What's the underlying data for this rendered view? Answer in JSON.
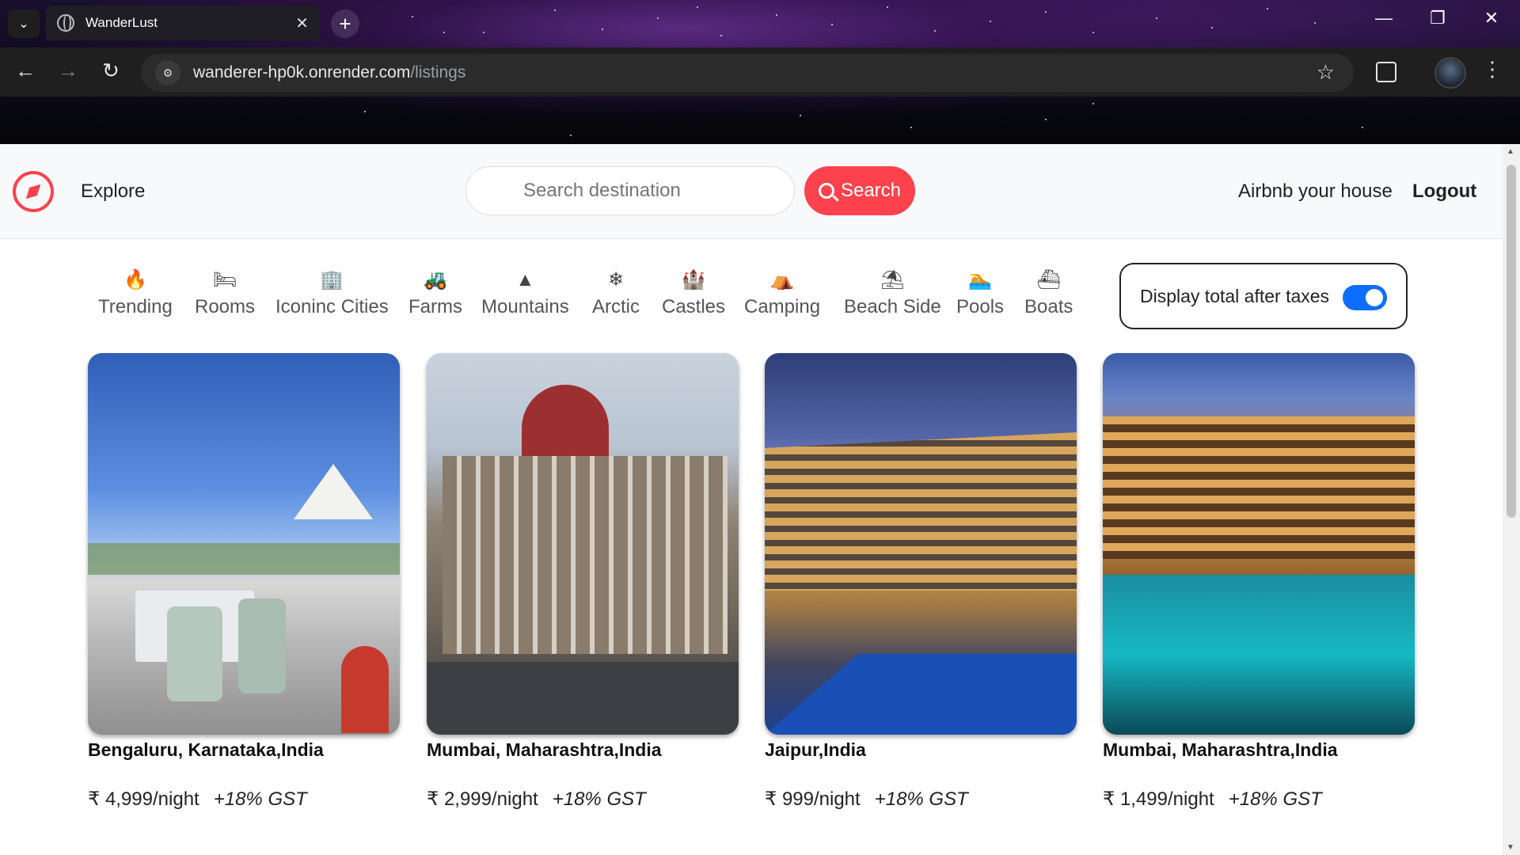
{
  "browser": {
    "tab_title": "WanderLust",
    "tab_close": "✕",
    "new_tab": "+",
    "url_host": "wanderer-hp0k.onrender.com",
    "url_path": "/listings",
    "window_controls": [
      "—",
      "❐",
      "✕"
    ]
  },
  "navbar": {
    "explore_label": "Explore",
    "search_placeholder": "Search destination",
    "search_button": "Search",
    "airbnb_link": "Airbnb your house",
    "logout_link": "Logout",
    "brand_color": "#fe424d"
  },
  "filters": [
    {
      "label": "Trending",
      "icon": "fire-icon",
      "glyph": "🔥"
    },
    {
      "label": "Rooms",
      "icon": "bed-icon",
      "glyph": "🛏"
    },
    {
      "label": "Iconinc Cities",
      "icon": "city-building-icon",
      "glyph": "🏢"
    },
    {
      "label": "Farms",
      "icon": "tractor-icon",
      "glyph": "🚜"
    },
    {
      "label": "Mountains",
      "icon": "mountain-icon",
      "glyph": "▲"
    },
    {
      "label": "Arctic",
      "icon": "snowflake-icon",
      "glyph": "❄"
    },
    {
      "label": "Castles",
      "icon": "castle-icon",
      "glyph": "🏰"
    },
    {
      "label": "Camping",
      "icon": "campground-icon",
      "glyph": "⛺"
    },
    {
      "label": "Beach Side",
      "icon": "umbrella-beach-icon",
      "glyph": "⛱"
    },
    {
      "label": "Pools",
      "icon": "swimmer-icon",
      "glyph": "🏊"
    },
    {
      "label": "Boats",
      "icon": "ship-icon",
      "glyph": "⛴"
    }
  ],
  "tax_toggle": {
    "label": "Display total after taxes",
    "checked": true,
    "accent": "#0d6efd"
  },
  "listings": [
    {
      "location": "Bengaluru, Karnataka,India",
      "price": "₹ 4,999/night",
      "tax": "+18% GST"
    },
    {
      "location": "Mumbai, Maharashtra,India",
      "price": "₹ 2,999/night",
      "tax": "+18% GST"
    },
    {
      "location": "Jaipur,India",
      "price": "₹ 999/night",
      "tax": "+18% GST"
    },
    {
      "location": "Mumbai, Maharashtra,India",
      "price": "₹ 1,499/night",
      "tax": "+18% GST"
    }
  ]
}
